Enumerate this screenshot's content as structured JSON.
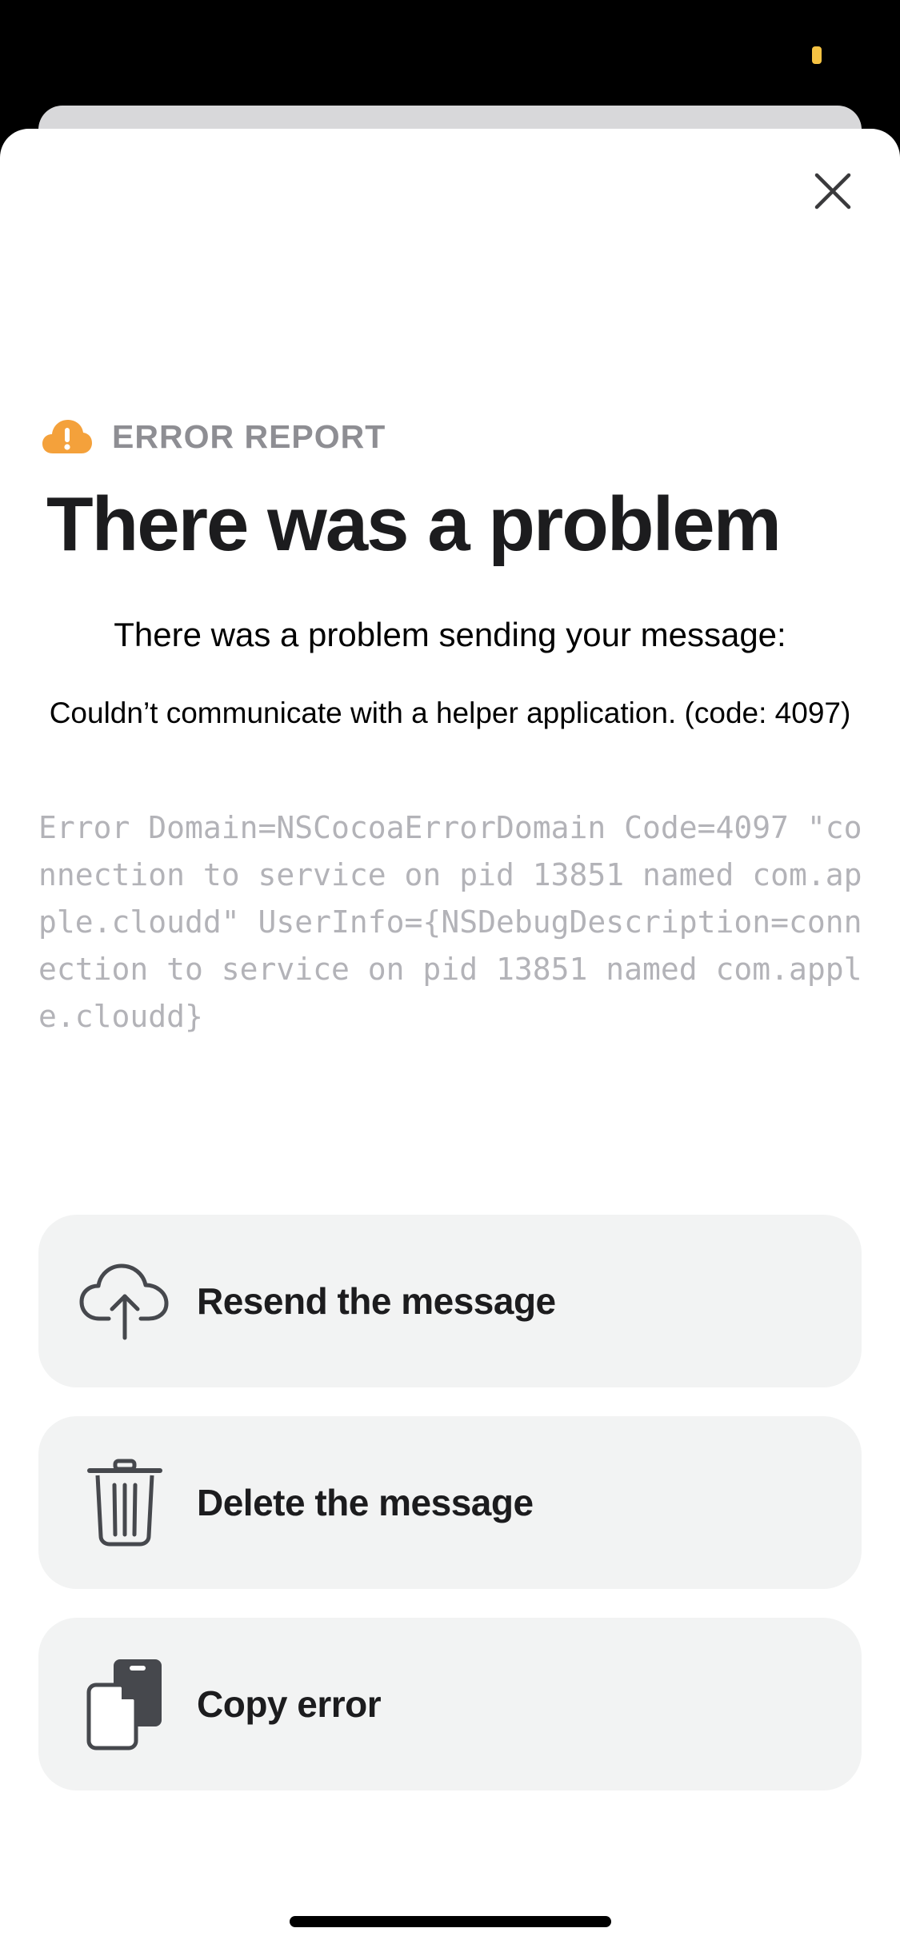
{
  "colors": {
    "background": "#000000",
    "sheet": "#ffffff",
    "accent_warning": "#f4a13b",
    "eyebrow_text": "#8e8e93",
    "title_text": "#1c1c1e",
    "debug_text": "#b3b3b8",
    "action_background": "#f2f3f3",
    "icon_dark": "#46484d",
    "status_indicator": "#f6c343"
  },
  "sheet": {
    "close_icon": "close-icon",
    "eyebrow": {
      "icon": "cloud-warning-icon",
      "label": "ERROR REPORT"
    },
    "title": "There was a problem",
    "message": "There was a problem sending your message:",
    "detail": "Couldn’t communicate with a helper application. (code: 4097)",
    "debug": "Error Domain=NSCocoaErrorDomain Code=4097 \"connection to service on pid 13851 named com.apple.cloudd\" UserInfo={NSDebugDescription=connection to service on pid 13851 named com.apple.cloudd}"
  },
  "actions": [
    {
      "icon": "cloud-upload-icon",
      "label": "Resend the message"
    },
    {
      "icon": "trash-icon",
      "label": "Delete the message"
    },
    {
      "icon": "copy-icon",
      "label": "Copy error"
    }
  ]
}
